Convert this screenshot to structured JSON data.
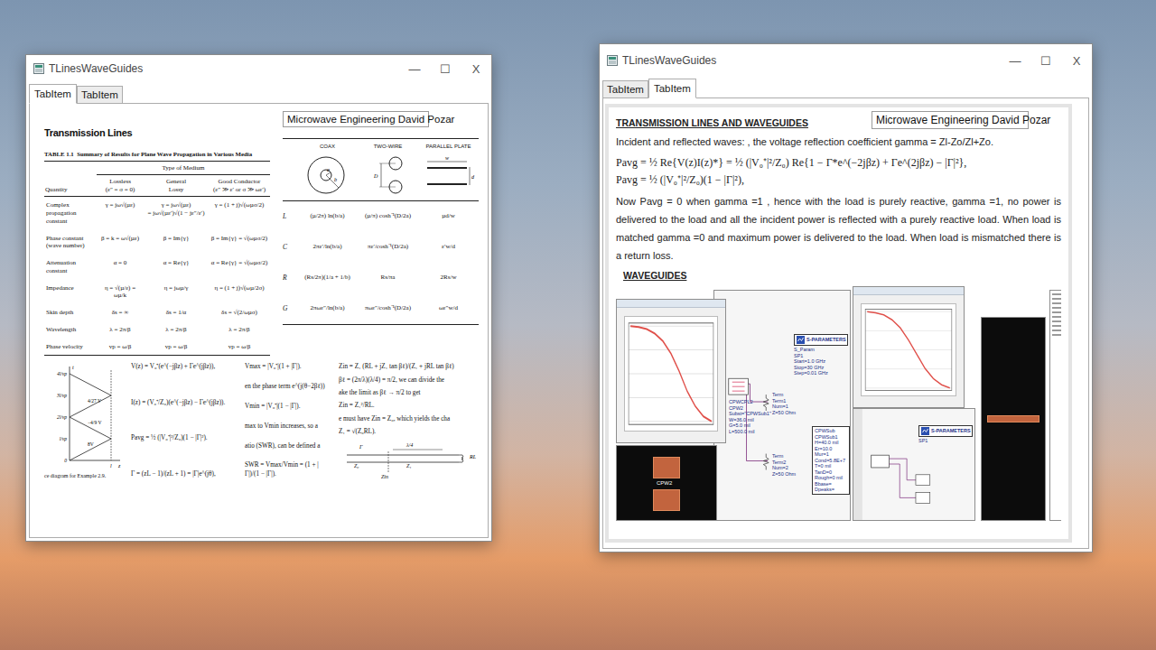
{
  "left_window": {
    "title": "TLinesWaveGuides",
    "controls": [
      "—",
      "☐",
      "X"
    ],
    "tabs": [
      {
        "label": "TabItem",
        "selected": true
      },
      {
        "label": "TabItem",
        "selected": false
      }
    ],
    "heading": "Transmission Lines",
    "book_field": "Microwave Engineering David Pozar",
    "summary_table": {
      "caption": "TABLE 1.1  Summary of Results for Plane Wave Propagation in Various Media",
      "group_header": "Type of Medium",
      "quantity_header": "Quantity",
      "columns": [
        {
          "title": "Lossless",
          "subtitle": "(ε″ = σ = 0)"
        },
        {
          "title": "General",
          "subtitle": "Lossy"
        },
        {
          "title": "Good Conductor",
          "subtitle": "(ε″ ≫ ε′ or σ ≫ ωε′)"
        }
      ],
      "rows": [
        {
          "label": "Complex propagation constant",
          "cells": [
            "γ = jω√(µε)",
            "γ = jω√(µε)\n= jω√(µε′)√(1 − jε″/ε′)",
            "γ = (1 + j)√(ωµσ/2)"
          ]
        },
        {
          "label": "Phase constant (wave number)",
          "cells": [
            "β = k = ω√(µε)",
            "β = Im{γ}",
            "β = Im{γ} = √(ωµσ/2)"
          ]
        },
        {
          "label": "Attenuation constant",
          "cells": [
            "α = 0",
            "α = Re{γ}",
            "α = Re{γ} = √(ωµσ/2)"
          ]
        },
        {
          "label": "Impedance",
          "cells": [
            "η = √(µ/ε) = ωµ/k",
            "η = jωµ/γ",
            "η = (1 + j)√(ωµ/2σ)"
          ]
        },
        {
          "label": "Skin depth",
          "cells": [
            "δs = ∞",
            "δs = 1/α",
            "δs = √(2/ωµσ)"
          ]
        },
        {
          "label": "Wavelength",
          "cells": [
            "λ = 2π/β",
            "λ = 2π/β",
            "λ = 2π/β"
          ]
        },
        {
          "label": "Phase velocity",
          "cells": [
            "vp = ω/β",
            "vp = ω/β",
            "vp = ω/β"
          ]
        }
      ]
    },
    "line_table": {
      "columns": [
        {
          "name": "COAX",
          "kind": "coax",
          "labels": [
            "a",
            "b"
          ]
        },
        {
          "name": "TWO-WIRE",
          "kind": "twowire",
          "labels": [
            "D"
          ]
        },
        {
          "name": "PARALLEL PLATE",
          "kind": "plates",
          "labels": [
            "w",
            "d"
          ]
        }
      ],
      "rows": [
        {
          "symbol": "L",
          "cells": [
            "(µ/2π) ln(b/a)",
            "(µ/π) cosh⁻¹(D/2a)",
            "µd/w"
          ]
        },
        {
          "symbol": "C",
          "cells": [
            "2πε′/ln(b/a)",
            "πε′/cosh⁻¹(D/2a)",
            "ε′w/d"
          ]
        },
        {
          "symbol": "R",
          "cells": [
            "(Rs/2π)(1/a + 1/b)",
            "Rs/πa",
            "2Rs/w"
          ]
        },
        {
          "symbol": "G",
          "cells": [
            "2πωε″/ln(b/a)",
            "πωε″/cosh⁻¹(D/2a)",
            "ωε″w/d"
          ]
        }
      ]
    },
    "bounce_diagram": {
      "time_labels": [
        "4l/vp",
        "3l/vp",
        "2l/vp",
        "l/vp",
        "0"
      ],
      "axis_t": "t",
      "axis_z": "z",
      "length_label": "l",
      "wave_labels": [
        "8V",
        "−4/9 V",
        "4/27 V"
      ],
      "caption": "ce diagram for Example 2.9."
    },
    "equations": {
      "left": [
        "V(z) = V₀⁺(e^(−jβz) + Γe^(jβz)),",
        "I(z) = (V₀⁺/Z₀)(e^(−jβz) − Γe^(jβz)).",
        "Pavg = ½ (|V₀⁺|²/Z₀)(1 − |Γ|²).",
        "Γ = (zL − 1)/(zL + 1) = |Γ|e^(jθ),"
      ],
      "right": [
        "Vmax = |V₀⁺|(1 + |Γ|).",
        "en the phase term e^(j(θ−2βℓ))",
        "Vmin = |V₀⁺|(1 − |Γ|).",
        "max to Vmin increases, so a",
        "atio (SWR), can be defined a",
        "SWR = Vmax/Vmin = (1 + |Γ|)/(1 − |Γ|)."
      ]
    },
    "zin": {
      "lines": [
        "Zin = Z₁ (RL + jZ₁ tan βℓ)/(Z₁ + jRL tan βℓ)",
        "βℓ = (2π/λ)(λ/4) = π/2, we can divide the",
        "ake the limit as βℓ → π/2 to get",
        "Zin = Z₁²/RL.",
        "e must have Zin = Z₀, which yields the cha",
        "Z₁ = √(Z₀RL)."
      ],
      "labels": [
        "Γ",
        "λ/4",
        "Z₀",
        "Z₁",
        "RL",
        "Zin"
      ]
    }
  },
  "right_window": {
    "title": "TLinesWaveGuides",
    "controls": [
      "—",
      "☐",
      "X"
    ],
    "tabs": [
      {
        "label": "TabItem",
        "selected": false
      },
      {
        "label": "TabItem",
        "selected": true
      }
    ],
    "heading": "TRANSMISSION LINES AND WAVEGUIDES",
    "book_field": "Microwave Engineering David Pozar",
    "intro": "Incident and reflected waves: , the voltage reflection coefficient gamma = Zl-Zo/Zl+Zo.",
    "formulas": [
      "Pavg = ½ Re{V(z)I(z)*} = ½ (|V₀⁺|²/Z₀) Re{1 − Γ*e^(−2jβz) + Γe^(2jβz) − |Γ|²},",
      "Pavg = ½ (|V₀⁺|²/Z₀)(1 − |Γ|²),"
    ],
    "body": "Now Pavg = 0 when gamma =1 , hence with the load is purely reactive, gamma =1, no power is delivered to the load and all the incident power is reflected with a  purely reactive load. When load is matched gamma =0 and maximum power is delivered to the load. When load is mismatched there is a return loss.",
    "subheading": "WAVEGUIDES",
    "collage": {
      "charts": [
        {
          "values": [
            0,
            -0.2,
            -0.6,
            -1.5,
            -3,
            -5.5,
            -9,
            -13,
            -16,
            -18,
            -19
          ]
        },
        {
          "values": [
            0,
            -0.3,
            -0.8,
            -2,
            -4,
            -7,
            -10.5,
            -14,
            -16.5,
            -18,
            -18.8
          ]
        }
      ],
      "sparam_boxes": [
        {
          "title": "S-PARAMETERS",
          "lines": [
            "S_Param",
            "SP1",
            "Start=1.0 GHz",
            "Stop=30 GHz",
            "Step=0.01 GHz"
          ]
        },
        {
          "title": "S-PARAMETERS",
          "lines": [
            "SP1"
          ]
        }
      ],
      "terms": [
        {
          "lines": [
            "Term",
            "Term1",
            "Num=1",
            "Z=50 Ohm"
          ]
        },
        {
          "lines": [
            "Term",
            "Term2",
            "Num=2",
            "Z=50 Ohm"
          ]
        }
      ],
      "cpw": {
        "lines": [
          "CPWCPL2",
          "CPW2",
          "Subst=\"CPWSub1\"",
          "W=36.0 mil",
          "G=5.0 mil",
          "L=500.0 mil"
        ]
      },
      "substrate": {
        "title": "CPWSub",
        "lines": [
          "CPWSub1",
          "H=40.0 mil",
          "Er=10.0",
          "Mur=1",
          "Cond=5.8E+7",
          "T=0 mil",
          "TanD=0",
          "Rough=0 mil",
          "Bbase=",
          "Dpeaks="
        ]
      },
      "layout_label": "CPW2"
    }
  }
}
